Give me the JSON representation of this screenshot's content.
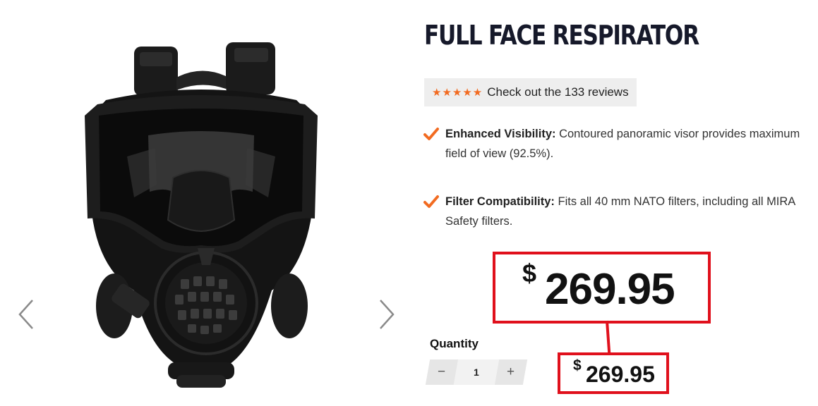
{
  "product": {
    "title": "FULL FACE RESPIRATOR",
    "image_icon": "gas-mask-image"
  },
  "reviews": {
    "stars": "★★★★★",
    "text": "Check out the 133 reviews",
    "rating": 5,
    "count": 133
  },
  "features": [
    {
      "heading": "Enhanced Visibility:",
      "body": " Contoured panoramic visor provides maximum field of view (92.5%)."
    },
    {
      "heading": "Filter Compatibility:",
      "body": " Fits all 40 mm NATO filters, including all MIRA Safety filters."
    }
  ],
  "price": {
    "currency": "$",
    "amount": "269.95"
  },
  "quantity": {
    "label": "Quantity",
    "minus": "−",
    "value": "1",
    "plus": "+"
  },
  "colors": {
    "accent": "#f26b21",
    "callout": "#e0101c",
    "title": "#16192a"
  },
  "icons": [
    "chevron-left-icon",
    "chevron-right-icon",
    "checkmark-icon",
    "star-icon"
  ]
}
